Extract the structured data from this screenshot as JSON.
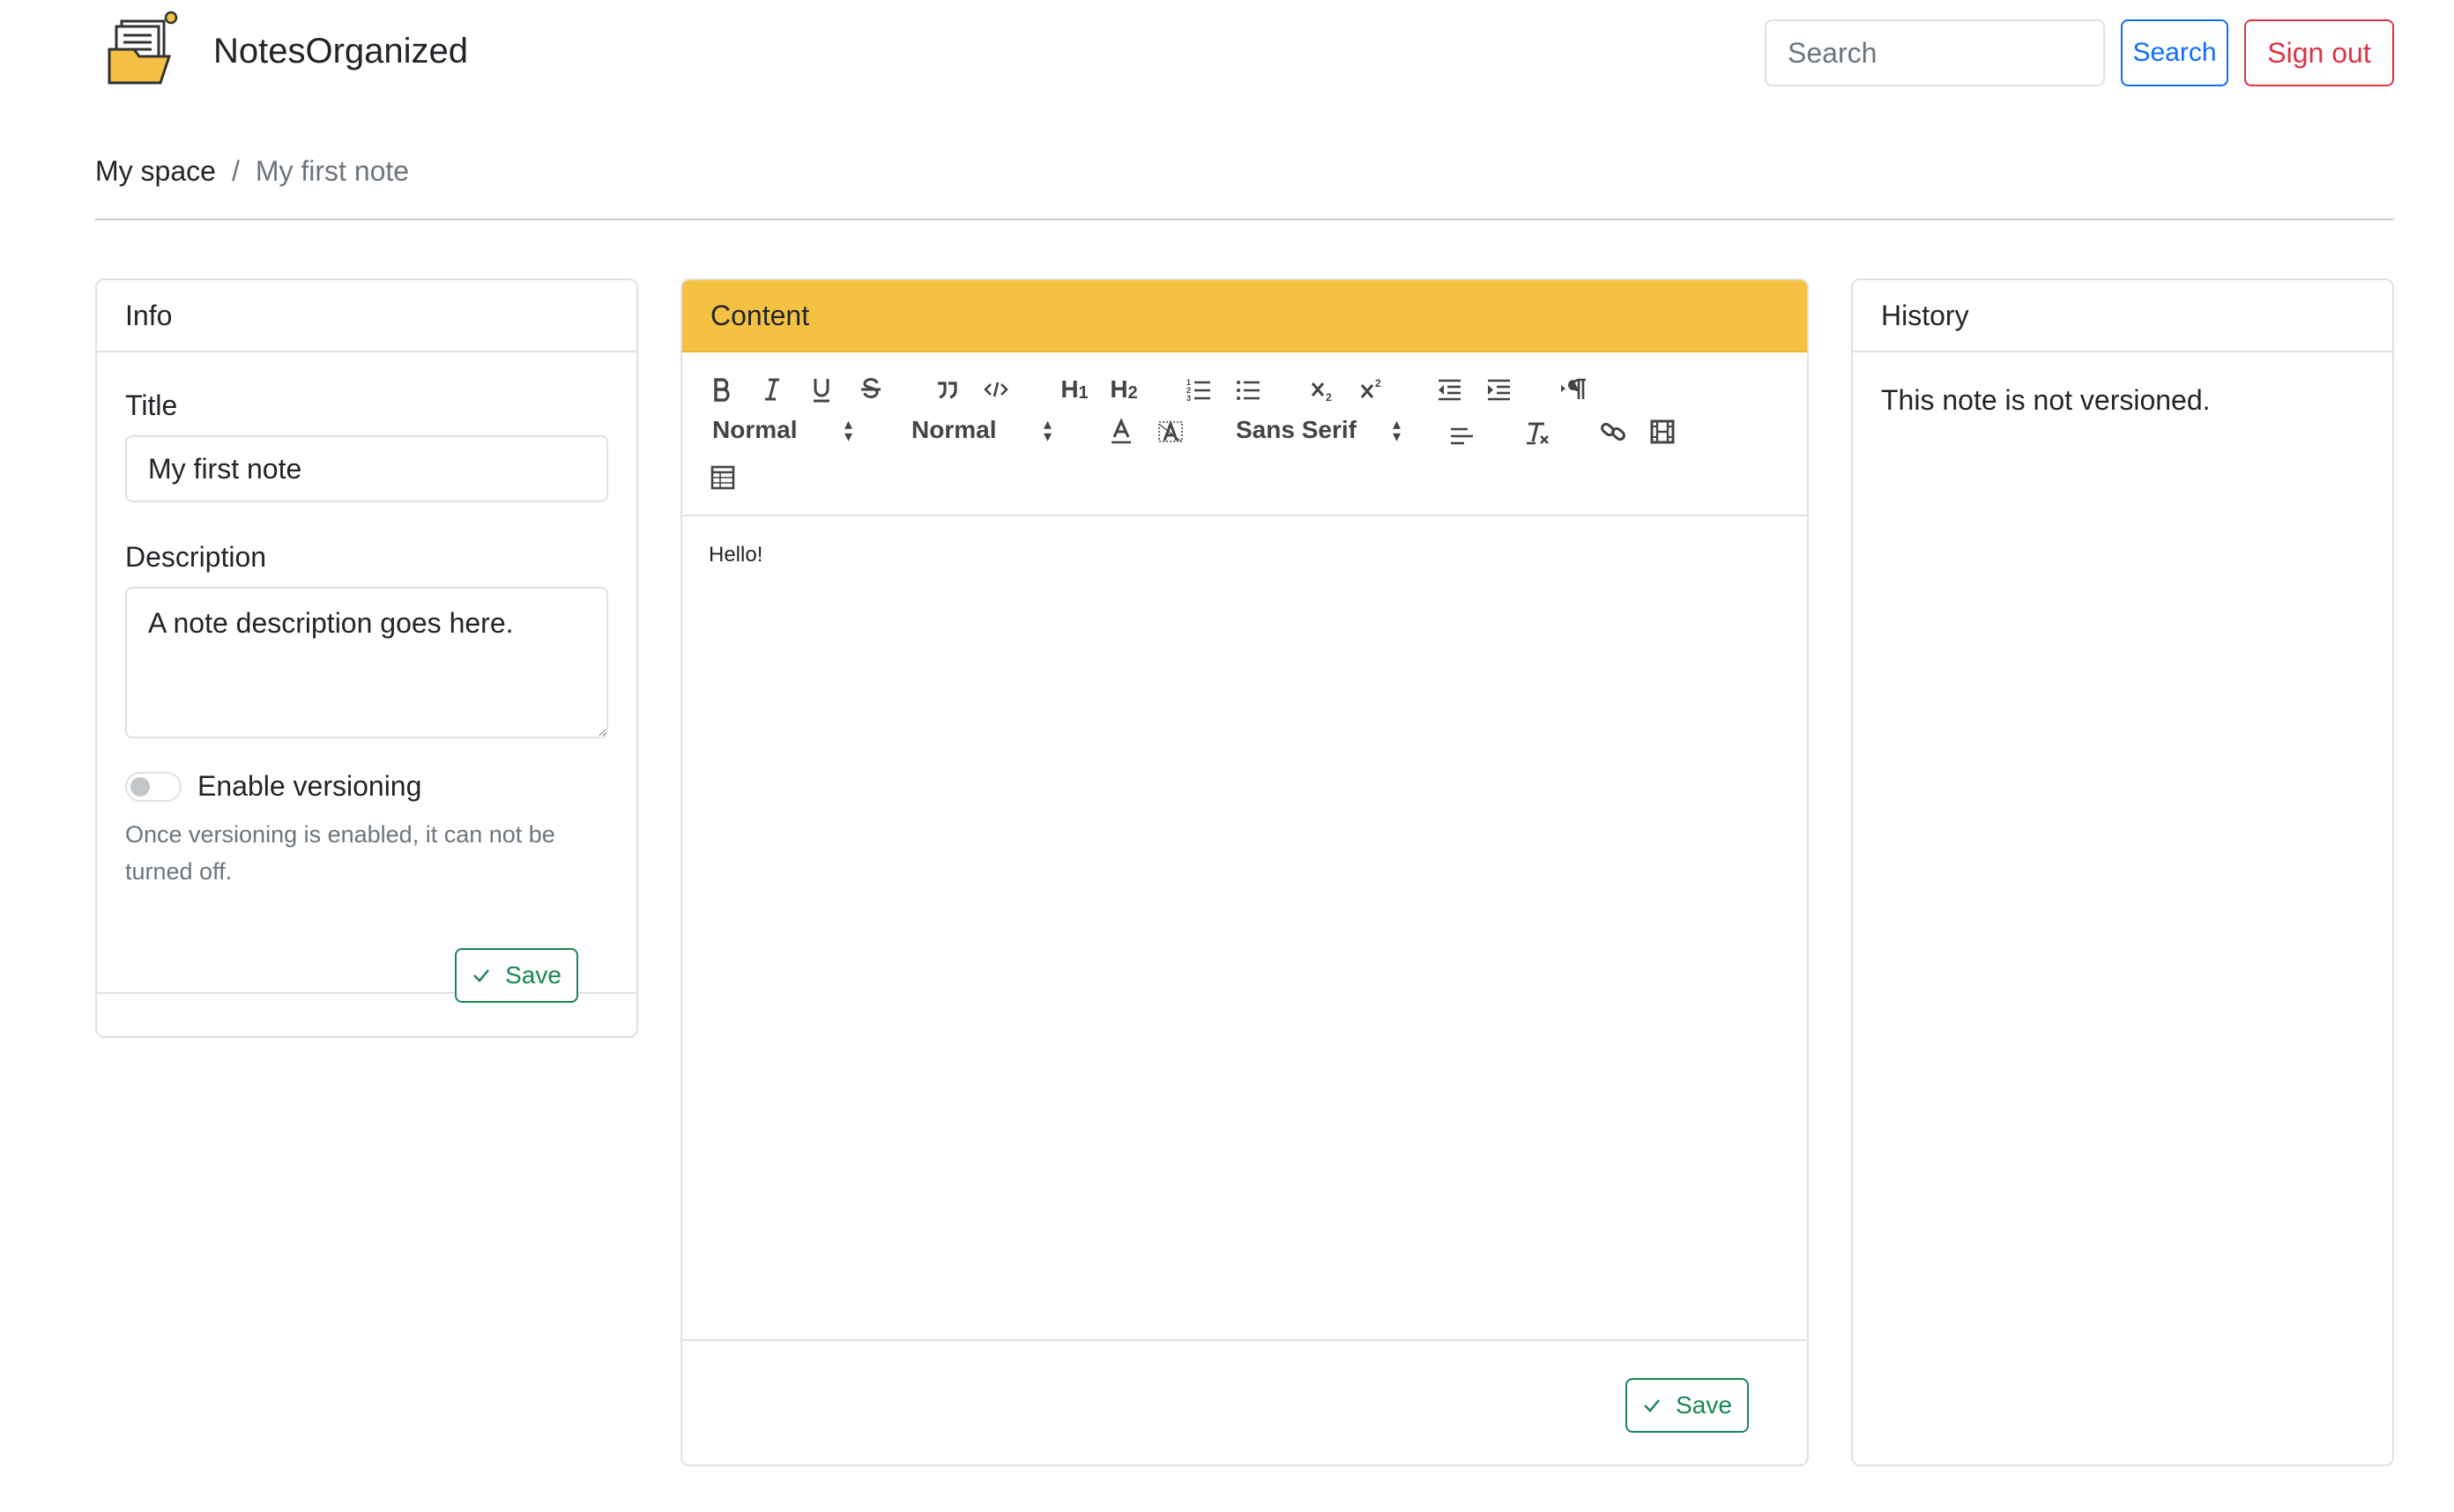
{
  "header": {
    "brand": "NotesOrganized",
    "search_placeholder": "Search",
    "search_button": "Search",
    "signout_button": "Sign out"
  },
  "breadcrumb": {
    "space": "My space",
    "separator": "/",
    "current": "My first note"
  },
  "info": {
    "header": "Info",
    "title_label": "Title",
    "title_value": "My first note",
    "description_label": "Description",
    "description_value": "A note description goes here.",
    "versioning_label": "Enable versioning",
    "versioning_enabled": false,
    "help_text": "Once versioning is enabled, it can not be turned off.",
    "save_button": "Save"
  },
  "content": {
    "header": "Content",
    "toolbar": {
      "header_select": "Normal",
      "size_select": "Normal",
      "font_select": "Sans Serif",
      "h1": "H1",
      "h2": "H2"
    },
    "editor_text": "Hello!",
    "save_button": "Save"
  },
  "history": {
    "header": "History",
    "message": "This note is not versioned."
  },
  "colors": {
    "primary": "#0d6efd",
    "danger": "#dc3545",
    "success": "#198754",
    "warning_header": "#f5c142"
  }
}
